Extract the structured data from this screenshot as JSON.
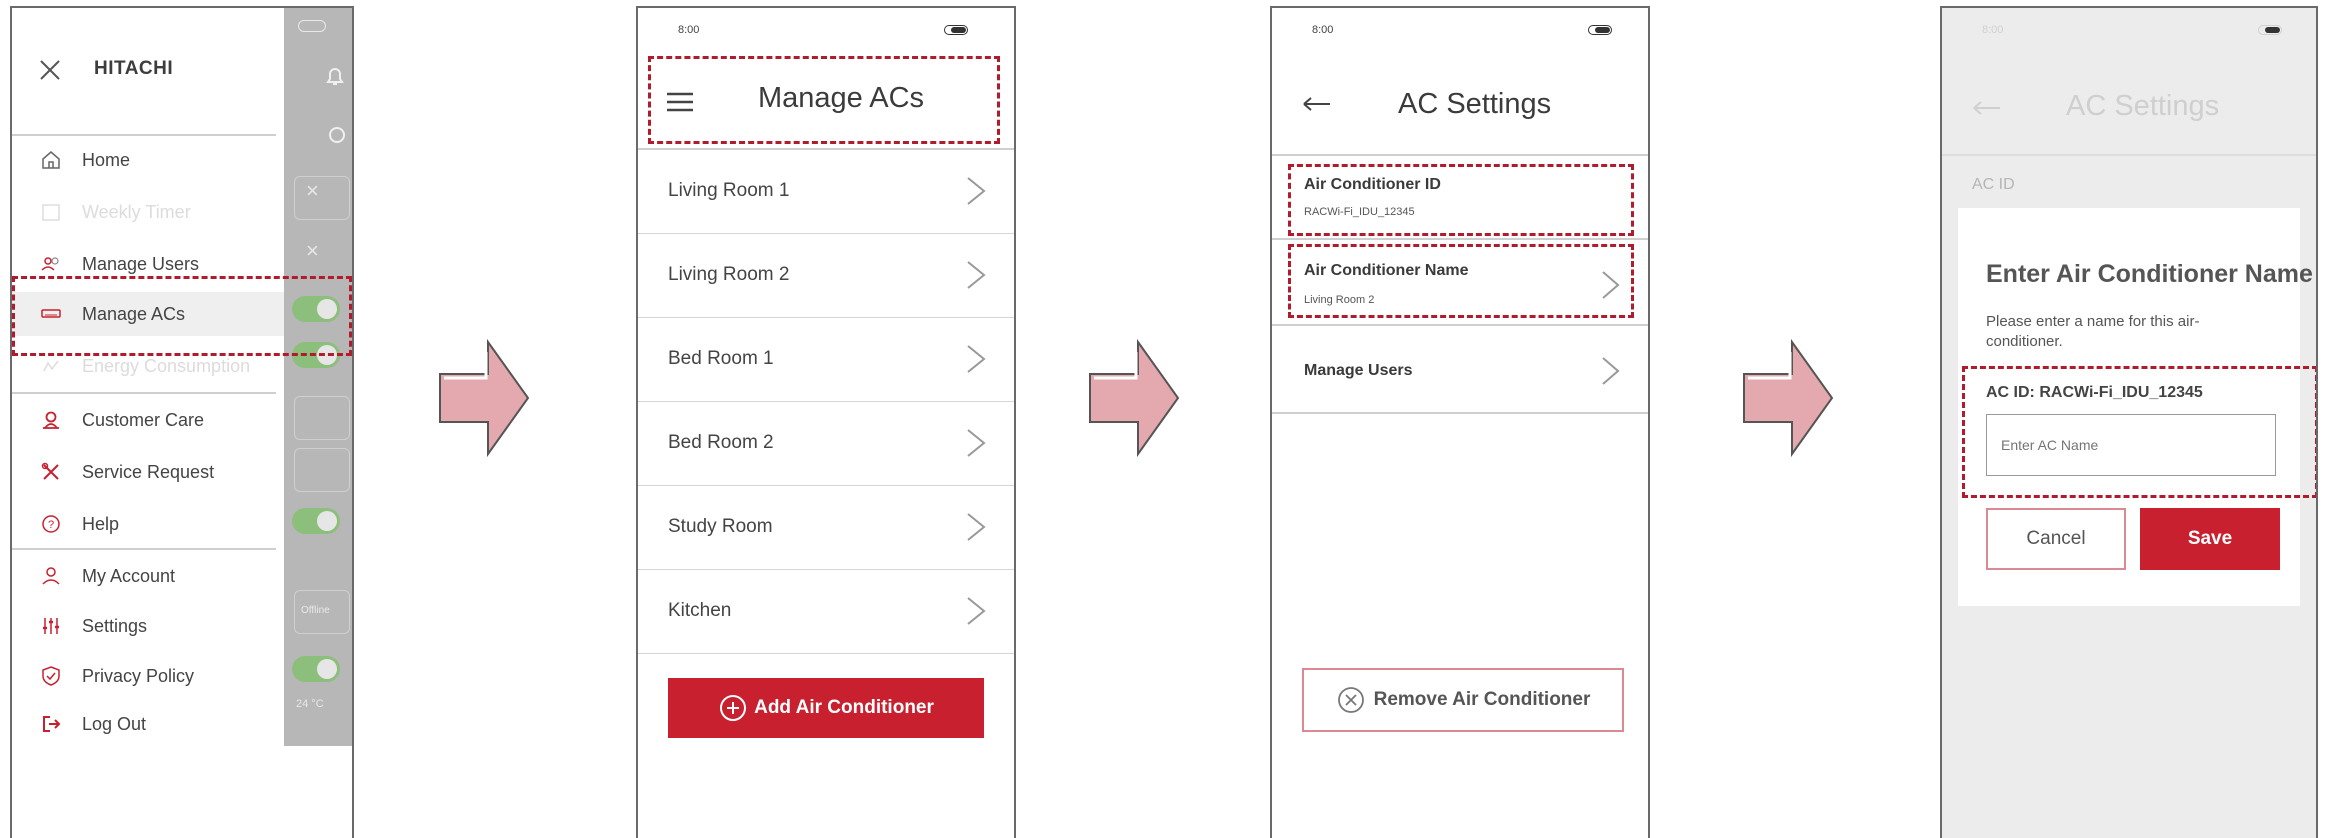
{
  "colors": {
    "accent": "#c8202f",
    "annotation": "#b01c2e",
    "toggle": "#8dbf7c"
  },
  "screen1": {
    "brand": "HITACHI",
    "close_icon": "close-icon",
    "menu": [
      {
        "label": "Home",
        "icon": "home-icon"
      },
      {
        "label": "Weekly Timer",
        "icon": "calendar-icon"
      },
      {
        "label": "Manage Users",
        "icon": "users-icon"
      },
      {
        "label": "Manage ACs",
        "icon": "ac-unit-icon"
      },
      {
        "label": "Energy Consumption",
        "icon": "energy-icon"
      },
      {
        "label": "Customer Care",
        "icon": "customer-care-icon"
      },
      {
        "label": "Service Request",
        "icon": "tools-icon"
      },
      {
        "label": "Help",
        "icon": "help-icon"
      },
      {
        "label": "My Account",
        "icon": "account-icon"
      },
      {
        "label": "Settings",
        "icon": "sliders-icon"
      },
      {
        "label": "Privacy Policy",
        "icon": "shield-icon"
      },
      {
        "label": "Log Out",
        "icon": "logout-icon"
      }
    ],
    "background_labels": {
      "status": "Offline",
      "temp": "24 °C"
    }
  },
  "screen2": {
    "time": "8:00",
    "title": "Manage ACs",
    "rooms": [
      "Living Room 1",
      "Living Room 2",
      "Bed Room 1",
      "Bed Room 2",
      "Study Room",
      "Kitchen"
    ],
    "add_button": "Add Air Conditioner"
  },
  "screen3": {
    "time": "8:00",
    "title": "AC Settings",
    "id_label": "Air Conditioner ID",
    "id_value": "RACWi-Fi_IDU_12345",
    "name_label": "Air Conditioner Name",
    "name_value": "Living Room 2",
    "manage_users": "Manage Users",
    "remove_button": "Remove Air Conditioner"
  },
  "screen4": {
    "time": "8:00",
    "title": "AC Settings",
    "ac_id_label": "AC ID",
    "dialog_title": "Enter Air Conditioner Name",
    "dialog_text": "Please enter a name for this air-conditioner.",
    "ac_id_line": "AC ID: RACWi-Fi_IDU_12345",
    "placeholder": "Enter AC Name",
    "cancel": "Cancel",
    "save": "Save"
  }
}
